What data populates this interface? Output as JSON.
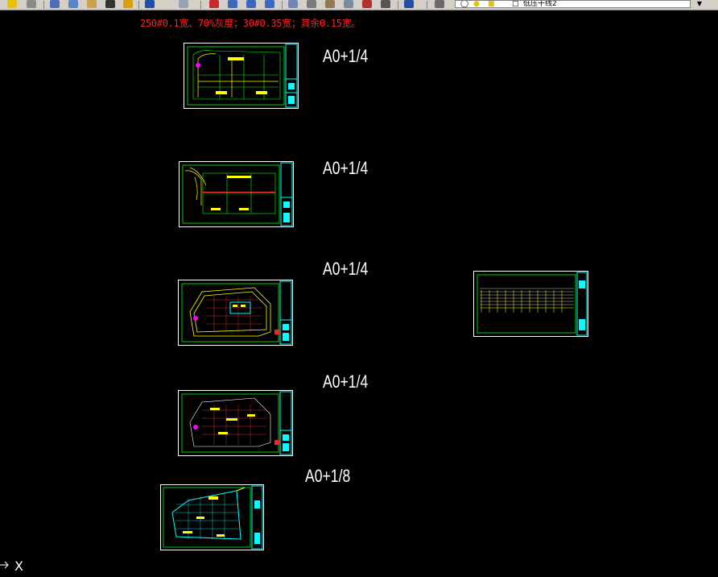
{
  "toolbar": {
    "layer_combo_value": "低压干线2",
    "colors": {
      "bg": "#d4d0c8",
      "icon_blue": "#1f4fa8",
      "icon_yellow": "#e6c200",
      "icon_red": "#c8282b"
    }
  },
  "note": {
    "text": "250#0.1宽、70%灰度；30#0.35宽；其余0.15宽。",
    "color": "#ff2020"
  },
  "sheets": [
    {
      "scale_label": "A0+1/4"
    },
    {
      "scale_label": "A0+1/4"
    },
    {
      "scale_label": "A0+1/4"
    },
    {
      "scale_label": "A0+1/4"
    },
    {
      "scale_label": "A0+1/8"
    },
    {
      "scale_label": ""
    }
  ],
  "ucs": {
    "axis_label": "X"
  },
  "colors": {
    "canvas": "#000000",
    "frame": "#ffffff",
    "title_block": "#00ffff",
    "lines": "#00ff00",
    "walls": "#ffff00",
    "grid": "#ff4040"
  }
}
